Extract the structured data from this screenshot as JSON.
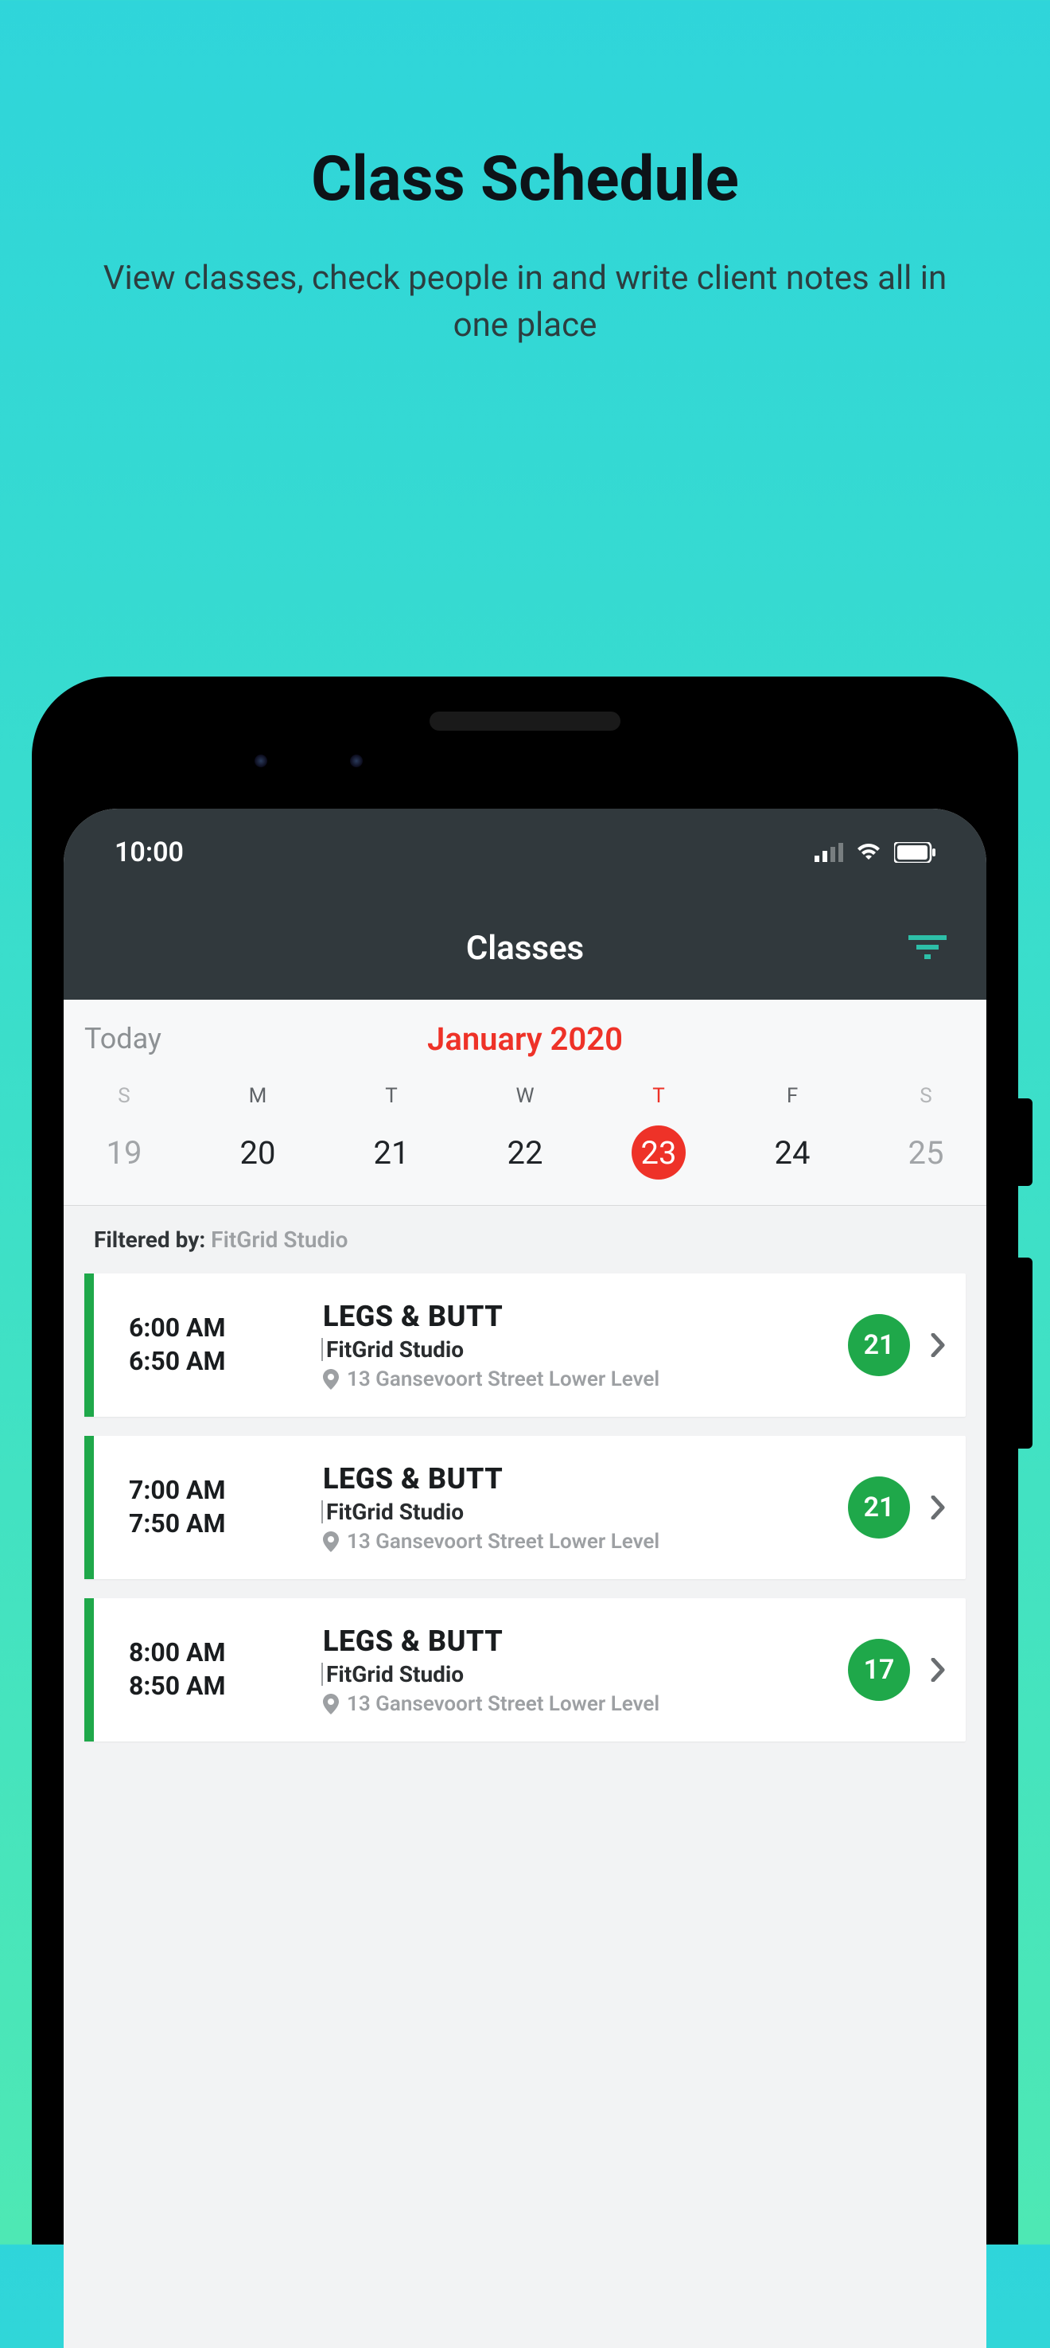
{
  "marketing": {
    "title": "Class Schedule",
    "subtitle": "View classes, check people in and write client notes all in one place"
  },
  "statusbar": {
    "time": "10:00"
  },
  "header": {
    "title": "Classes"
  },
  "calendar": {
    "today_label": "Today",
    "month_label": "January 2020",
    "days": [
      {
        "letter": "S",
        "number": "19",
        "weekend": true,
        "selected": false
      },
      {
        "letter": "M",
        "number": "20",
        "weekend": false,
        "selected": false
      },
      {
        "letter": "T",
        "number": "21",
        "weekend": false,
        "selected": false
      },
      {
        "letter": "W",
        "number": "22",
        "weekend": false,
        "selected": false
      },
      {
        "letter": "T",
        "number": "23",
        "weekend": false,
        "selected": true
      },
      {
        "letter": "F",
        "number": "24",
        "weekend": false,
        "selected": false
      },
      {
        "letter": "S",
        "number": "25",
        "weekend": true,
        "selected": false
      }
    ]
  },
  "filter": {
    "label": "Filtered by: ",
    "value": "FitGrid Studio"
  },
  "classes": [
    {
      "start": "6:00 AM",
      "end": "6:50 AM",
      "name": "LEGS & BUTT",
      "studio": "FitGrid Studio",
      "address": "13 Gansevoort Street Lower Level",
      "count": "21"
    },
    {
      "start": "7:00 AM",
      "end": "7:50 AM",
      "name": "LEGS & BUTT",
      "studio": "FitGrid Studio",
      "address": "13 Gansevoort Street Lower Level",
      "count": "21"
    },
    {
      "start": "8:00 AM",
      "end": "8:50 AM",
      "name": "LEGS & BUTT",
      "studio": "FitGrid Studio",
      "address": "13 Gansevoort Street Lower Level",
      "count": "17"
    }
  ]
}
